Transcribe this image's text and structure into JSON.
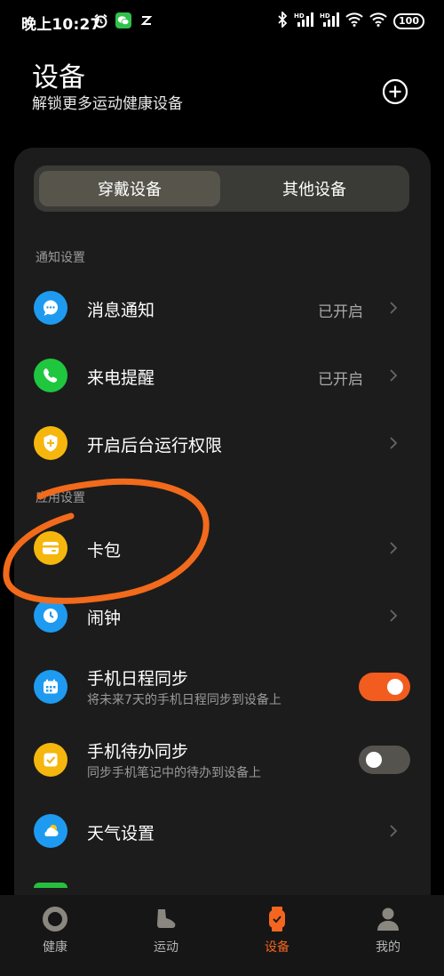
{
  "status_bar": {
    "time": "晚上10:27",
    "battery": "100"
  },
  "header": {
    "title": "设备",
    "subtitle": "解锁更多运动健康设备"
  },
  "segment": {
    "tabs": [
      {
        "label": "穿戴设备",
        "active": true
      },
      {
        "label": "其他设备",
        "active": false
      }
    ]
  },
  "sections": {
    "notify_label": "通知设置",
    "app_label": "应用设置"
  },
  "rows": {
    "messages": {
      "title": "消息通知",
      "status": "已开启",
      "icon": "message-bubble-icon",
      "color": "#1e9bf0"
    },
    "calls": {
      "title": "来电提醒",
      "status": "已开启",
      "icon": "phone-icon",
      "color": "#1fc73f"
    },
    "background": {
      "title": "开启后台运行权限",
      "icon": "shield-icon",
      "color": "#f5b70d"
    },
    "wallet": {
      "title": "卡包",
      "icon": "card-icon",
      "color": "#f5b70d"
    },
    "alarm": {
      "title": "闹钟",
      "icon": "clock-icon",
      "color": "#1e9bf0"
    },
    "calendar": {
      "title": "手机日程同步",
      "desc": "将未来7天的手机日程同步到设备上",
      "icon": "calendar-icon",
      "color": "#1e9bf0",
      "toggle_on": true
    },
    "todo": {
      "title": "手机待办同步",
      "desc": "同步手机笔记中的待办到设备上",
      "icon": "checkbox-icon",
      "color": "#f5b70d",
      "toggle_on": false
    },
    "weather": {
      "title": "天气设置",
      "icon": "weather-icon",
      "color": "#1e9bf0"
    }
  },
  "bottom_nav": [
    {
      "label": "健康",
      "icon": "health-ring-icon",
      "active": false
    },
    {
      "label": "运动",
      "icon": "shoe-icon",
      "active": false
    },
    {
      "label": "设备",
      "icon": "watch-icon",
      "active": true
    },
    {
      "label": "我的",
      "icon": "person-icon",
      "active": false
    }
  ],
  "colors": {
    "accent": "#f25c1e",
    "card_bg": "#1c1c1c",
    "scribble": "#f26a1b"
  }
}
